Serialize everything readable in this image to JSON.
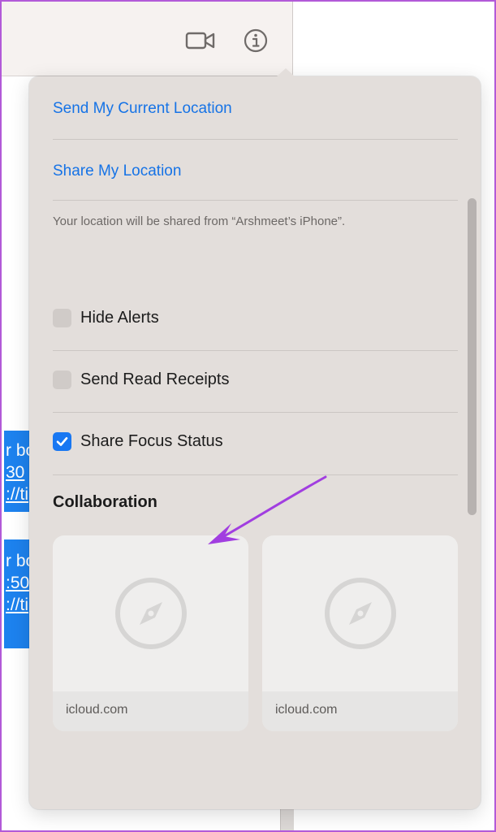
{
  "background": {
    "bubbles": [
      {
        "lines": [
          "r bo",
          "30",
          "://ti"
        ]
      },
      {
        "lines": [
          "r bo",
          ":50",
          "://ti"
        ]
      }
    ],
    "toolbar_icons": [
      "video-camera-icon",
      "info-circle-icon"
    ]
  },
  "popover": {
    "send_location_label": "Send My Current Location",
    "share_location_label": "Share My Location",
    "location_note": "Your location will be shared from “Arshmeet’s iPhone”.",
    "options": [
      {
        "label": "Hide Alerts",
        "checked": false
      },
      {
        "label": "Send Read Receipts",
        "checked": false
      },
      {
        "label": "Share Focus Status",
        "checked": true
      }
    ],
    "collaboration_title": "Collaboration",
    "cards": [
      {
        "label": "icloud.com",
        "icon": "compass-icon"
      },
      {
        "label": "icloud.com",
        "icon": "compass-icon"
      }
    ]
  },
  "colors": {
    "accent": "#1673e6",
    "checkbox_checked": "#1877f2",
    "annotation_arrow": "#a13ee0",
    "frame_border": "#b25ad8"
  }
}
